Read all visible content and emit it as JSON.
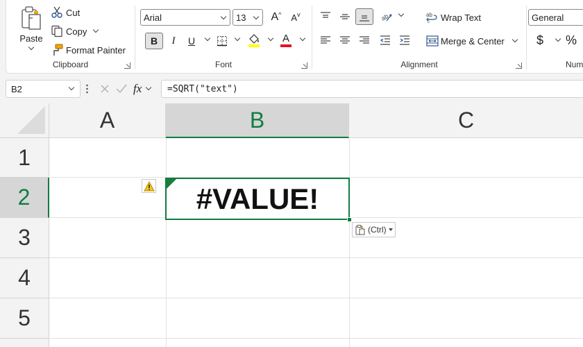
{
  "ribbon": {
    "clipboard": {
      "group_label": "Clipboard",
      "paste_label": "Paste",
      "cut_label": "Cut",
      "copy_label": "Copy",
      "format_painter_label": "Format Painter"
    },
    "font": {
      "group_label": "Font",
      "font_name": "Arial",
      "font_size": "13",
      "bold_label": "B",
      "italic_label": "I",
      "underline_label": "U",
      "grow_label": "A",
      "shrink_label": "A",
      "font_color_label": "A",
      "highlight_color": "#ffff00",
      "font_color": "#e81123"
    },
    "alignment": {
      "group_label": "Alignment",
      "wrap_text_label": "Wrap Text",
      "merge_center_label": "Merge & Center"
    },
    "number": {
      "group_label": "Numb",
      "format_value": "General",
      "currency_label": "$",
      "percent_label": "%"
    }
  },
  "formula_bar": {
    "name_box": "B2",
    "fx_label": "fx",
    "formula": "=SQRT(\"text\")"
  },
  "grid": {
    "columns": [
      "A",
      "B",
      "C"
    ],
    "rows": [
      "1",
      "2",
      "3",
      "4",
      "5"
    ],
    "active_cell_value": "#VALUE!",
    "accent_color": "#107c41"
  },
  "paste_options": {
    "label": "(Ctrl)"
  }
}
